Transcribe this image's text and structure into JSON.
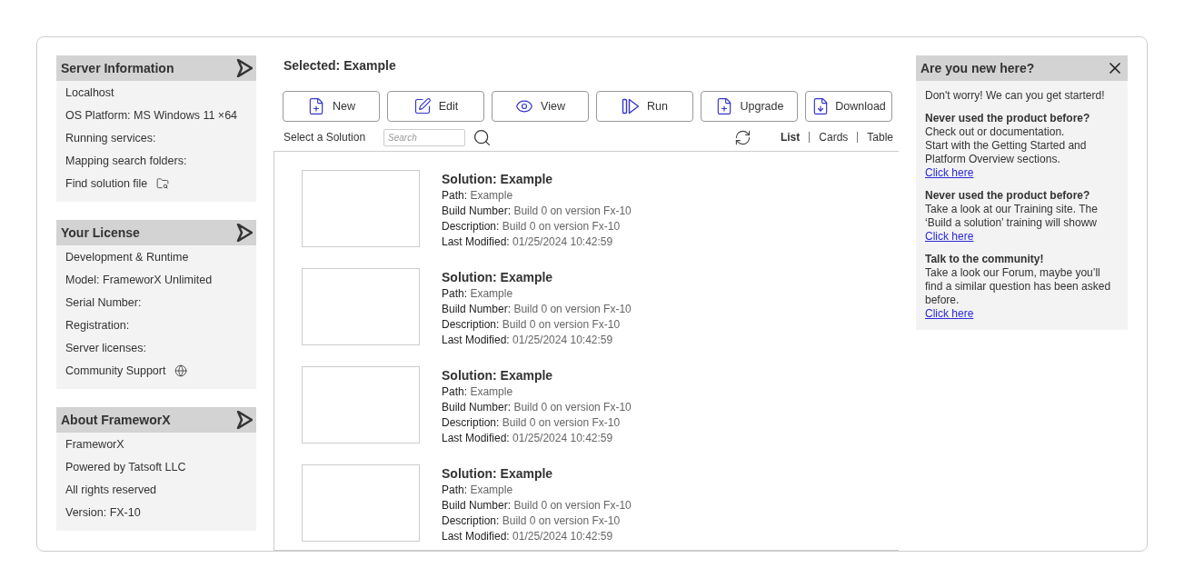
{
  "sidebar": {
    "sections": [
      {
        "title": "Server Information",
        "items": [
          {
            "text": "Localhost"
          },
          {
            "text": "OS Platform: MS Windows 11 ×64"
          },
          {
            "text": "Running services:"
          },
          {
            "text": "Mapping search folders:"
          },
          {
            "text": "Find solution file",
            "kind": "folder"
          }
        ]
      },
      {
        "title": "Your License",
        "items": [
          {
            "text": "Development & Runtime"
          },
          {
            "text": "Model: FrameworX Unlimited"
          },
          {
            "text": "Serial Number:"
          },
          {
            "text": "Registration:"
          },
          {
            "text": "Server licenses:"
          },
          {
            "text": "Community Support",
            "kind": "globe"
          }
        ]
      },
      {
        "title": "About FrameworX",
        "items": [
          {
            "text": "FrameworX"
          },
          {
            "text": "Powered by Tatsoft LLC"
          },
          {
            "text": "All rights reserved"
          },
          {
            "text": "Version: FX-10"
          }
        ]
      }
    ]
  },
  "main": {
    "selected": "Selected: Example",
    "buttons": [
      {
        "label": "New",
        "kind": "new"
      },
      {
        "label": "Edit",
        "kind": "edit"
      },
      {
        "label": "View",
        "kind": "view"
      },
      {
        "label": "Run",
        "kind": "run"
      },
      {
        "label": "Upgrade",
        "kind": "new"
      },
      {
        "label": "Download",
        "kind": "download"
      }
    ],
    "filter_label": "Select a Solution",
    "search": {
      "placeholder": "Search"
    },
    "views": [
      {
        "label": "List",
        "selected": true
      },
      {
        "label": "Cards",
        "selected": false
      },
      {
        "label": "Table",
        "selected": false
      }
    ],
    "solutions": [
      {
        "title": "Solution: Example",
        "details": [
          {
            "label": "Path:",
            "value": "Example"
          },
          {
            "label": "Build Number:",
            "value": "Build 0 on version Fx-10"
          },
          {
            "label": "Description:",
            "value": "Build 0 on version Fx-10"
          },
          {
            "label": "Last Modified:",
            "value": "01/25/2024 10:42:59"
          }
        ]
      },
      {
        "title": "Solution: Example",
        "details": [
          {
            "label": "Path:",
            "value": "Example"
          },
          {
            "label": "Build Number:",
            "value": "Build 0 on version Fx-10"
          },
          {
            "label": "Description:",
            "value": "Build 0 on version Fx-10"
          },
          {
            "label": "Last Modified:",
            "value": "01/25/2024 10:42:59"
          }
        ]
      },
      {
        "title": "Solution: Example",
        "details": [
          {
            "label": "Path:",
            "value": "Example"
          },
          {
            "label": "Build Number:",
            "value": "Build 0 on version Fx-10"
          },
          {
            "label": "Description:",
            "value": "Build 0 on version Fx-10"
          },
          {
            "label": "Last Modified:",
            "value": "01/25/2024 10:42:59"
          }
        ]
      },
      {
        "title": "Solution: Example",
        "details": [
          {
            "label": "Path:",
            "value": "Example"
          },
          {
            "label": "Build Number:",
            "value": "Build 0 on version Fx-10"
          },
          {
            "label": "Description:",
            "value": "Build 0 on version Fx-10"
          },
          {
            "label": "Last Modified:",
            "value": "01/25/2024 10:42:59"
          }
        ]
      }
    ]
  },
  "welcome": {
    "title": "Are you new here?",
    "intro": "Don't worry! We can you get starterd!",
    "blocks": [
      {
        "heading": "Never used the product before?",
        "lines": [
          "Check out or documentation.",
          "Start with the Getting Started and Platform Overview sections."
        ],
        "link": "Click here"
      },
      {
        "heading": "Never used the product before?",
        "lines": [
          "Take a look at our Training site. The ‘Build a solution’ training will showw"
        ],
        "link": "Click here"
      },
      {
        "heading": "Talk to the community!",
        "lines": [
          "Take a look our Forum, maybe you’ll find a similar question has been asked before."
        ],
        "link": "Click here"
      }
    ]
  }
}
